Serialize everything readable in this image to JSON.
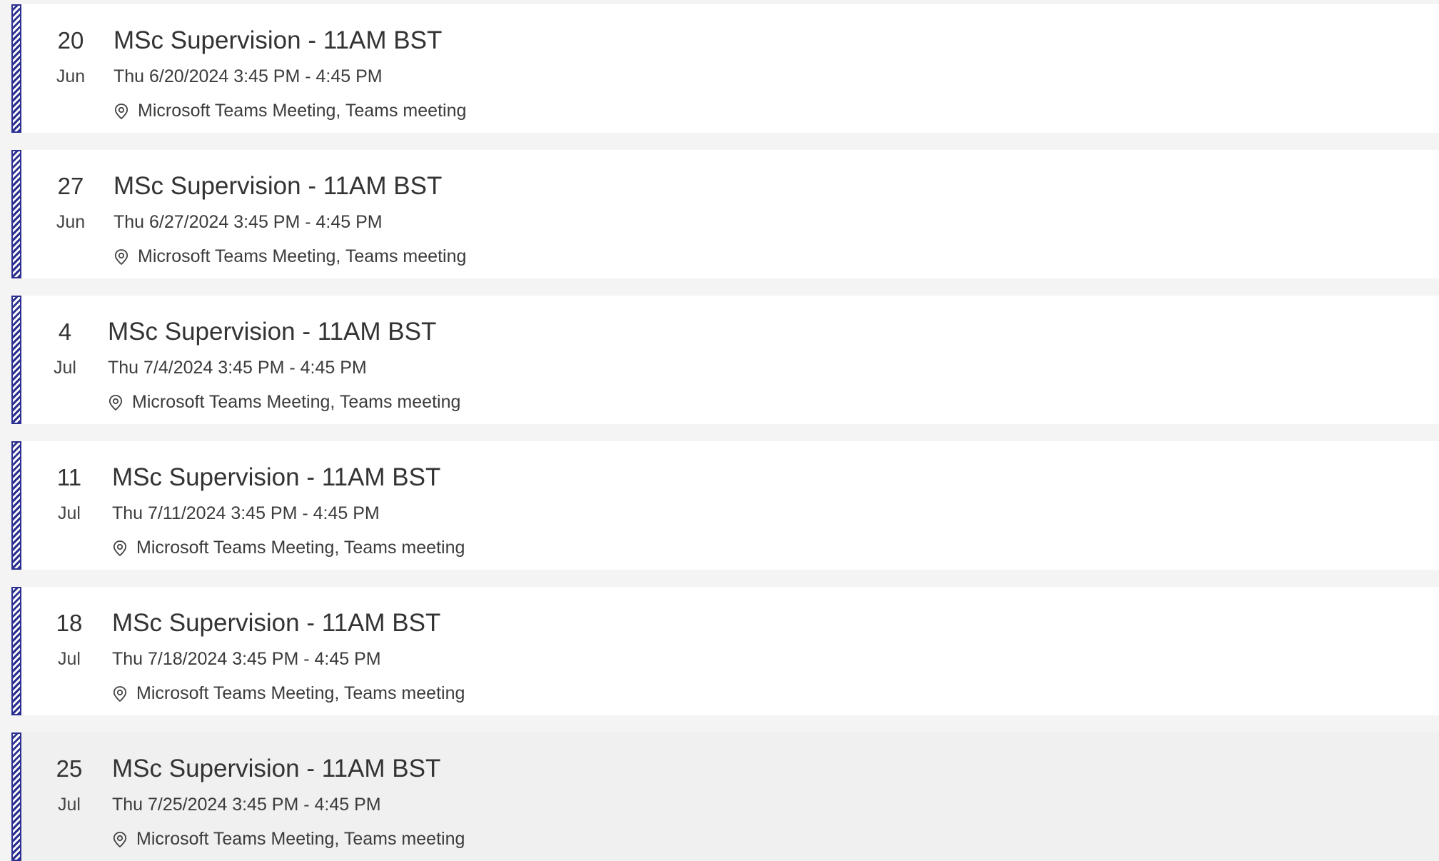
{
  "theme": {
    "stripe_color": "#2b2f8f",
    "selected_background": "#f0f0f0",
    "page_background": "#f4f4f4"
  },
  "events": [
    {
      "day": "20",
      "month": "Jun",
      "title": "MSc Supervision - 11AM BST",
      "datetime": "Thu 6/20/2024 3:45 PM - 4:45 PM",
      "location": "Microsoft Teams Meeting, Teams meeting",
      "location_icon": "location-pin-icon"
    },
    {
      "day": "27",
      "month": "Jun",
      "title": "MSc Supervision - 11AM BST",
      "datetime": "Thu 6/27/2024 3:45 PM - 4:45 PM",
      "location": "Microsoft Teams Meeting, Teams meeting",
      "location_icon": "location-pin-icon"
    },
    {
      "day": "4",
      "month": "Jul",
      "title": "MSc Supervision - 11AM BST",
      "datetime": "Thu 7/4/2024 3:45 PM - 4:45 PM",
      "location": "Microsoft Teams Meeting, Teams meeting",
      "location_icon": "location-pin-icon"
    },
    {
      "day": "11",
      "month": "Jul",
      "title": "MSc Supervision - 11AM BST",
      "datetime": "Thu 7/11/2024 3:45 PM - 4:45 PM",
      "location": "Microsoft Teams Meeting, Teams meeting",
      "location_icon": "location-pin-icon"
    },
    {
      "day": "18",
      "month": "Jul",
      "title": "MSc Supervision - 11AM BST",
      "datetime": "Thu 7/18/2024 3:45 PM - 4:45 PM",
      "location": "Microsoft Teams Meeting, Teams meeting",
      "location_icon": "location-pin-icon"
    },
    {
      "day": "25",
      "month": "Jul",
      "title": "MSc Supervision - 11AM BST",
      "datetime": "Thu 7/25/2024 3:45 PM - 4:45 PM",
      "location": "Microsoft Teams Meeting, Teams meeting",
      "location_icon": "location-pin-icon",
      "selected": true
    }
  ]
}
